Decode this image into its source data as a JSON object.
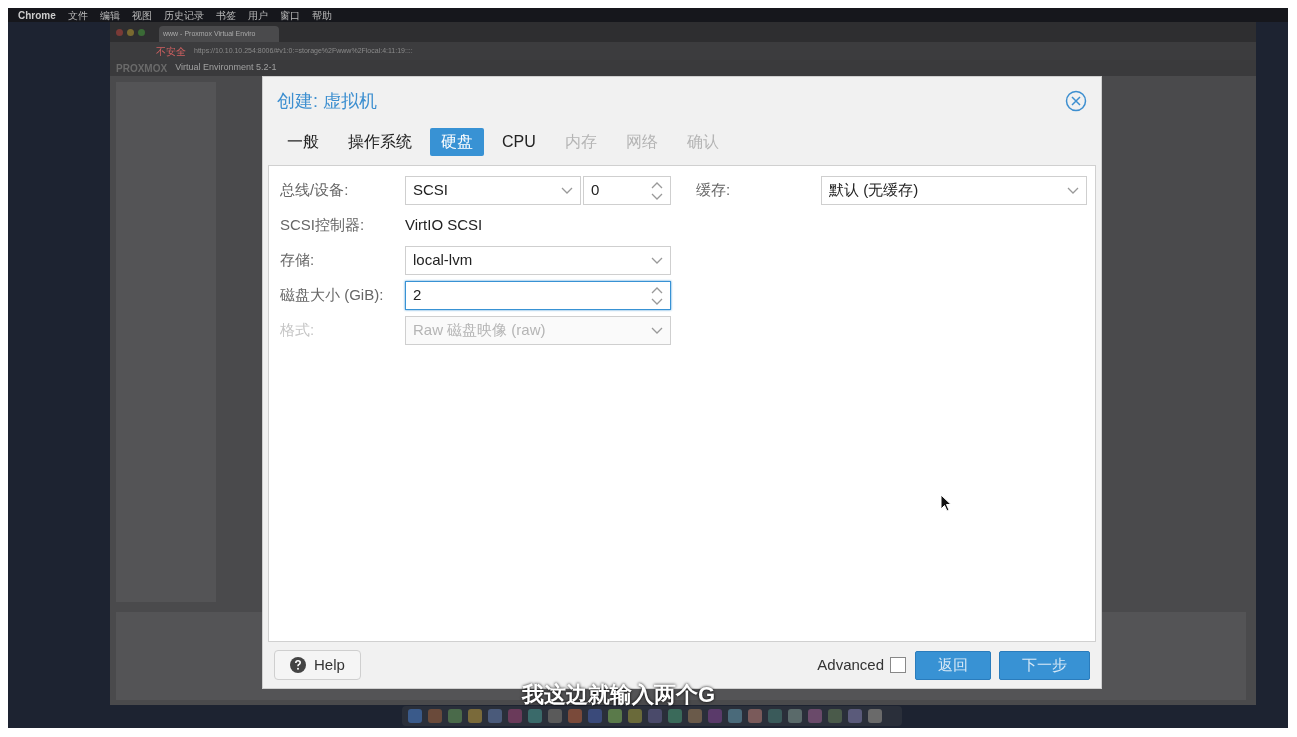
{
  "menu_bar": {
    "items": [
      "Chrome",
      "文件",
      "编辑",
      "视图",
      "历史记录",
      "书签",
      "用户",
      "窗口",
      "帮助"
    ]
  },
  "browser": {
    "tab_title": "www - Proxmox Virtual Enviro",
    "security": "不安全",
    "url": "https://10.10.10.254:8006/#v1:0:=storage%2Fwww%2Flocal:4:11:19::::",
    "app_name": "PROXMOX",
    "app_version": "Virtual Environment 5.2-1"
  },
  "dialog": {
    "title": "创建: 虚拟机",
    "tabs": [
      {
        "label": "一般",
        "selected": false,
        "disabled": false
      },
      {
        "label": "操作系统",
        "selected": false,
        "disabled": false
      },
      {
        "label": "硬盘",
        "selected": true,
        "disabled": false
      },
      {
        "label": "CPU",
        "selected": false,
        "disabled": false
      },
      {
        "label": "内存",
        "selected": false,
        "disabled": true
      },
      {
        "label": "网络",
        "selected": false,
        "disabled": true
      },
      {
        "label": "确认",
        "selected": false,
        "disabled": true
      }
    ],
    "fields": [
      {
        "label": "总线/设备:",
        "kind": "bus",
        "value": "SCSI",
        "number": "0",
        "disabled": false,
        "focused": false
      },
      {
        "label": "SCSI控制器:",
        "kind": "display",
        "value": "VirtIO SCSI",
        "disabled": false,
        "focused": false
      },
      {
        "label": "存储:",
        "kind": "combo",
        "value": "local-lvm",
        "disabled": false,
        "focused": false
      },
      {
        "label": "磁盘大小 (GiB):",
        "kind": "number",
        "value": "2",
        "disabled": false,
        "focused": true
      },
      {
        "label": "格式:",
        "kind": "combo",
        "value": "Raw 磁盘映像 (raw)",
        "disabled": true,
        "focused": false
      }
    ],
    "cache": {
      "label": "缓存:",
      "value": "默认 (无缓存)"
    },
    "help": "Help",
    "advanced": {
      "label": "Advanced",
      "checked": false
    },
    "buttons": [
      "返回",
      "下一步"
    ]
  },
  "subtitle": "我这边就输入两个G"
}
